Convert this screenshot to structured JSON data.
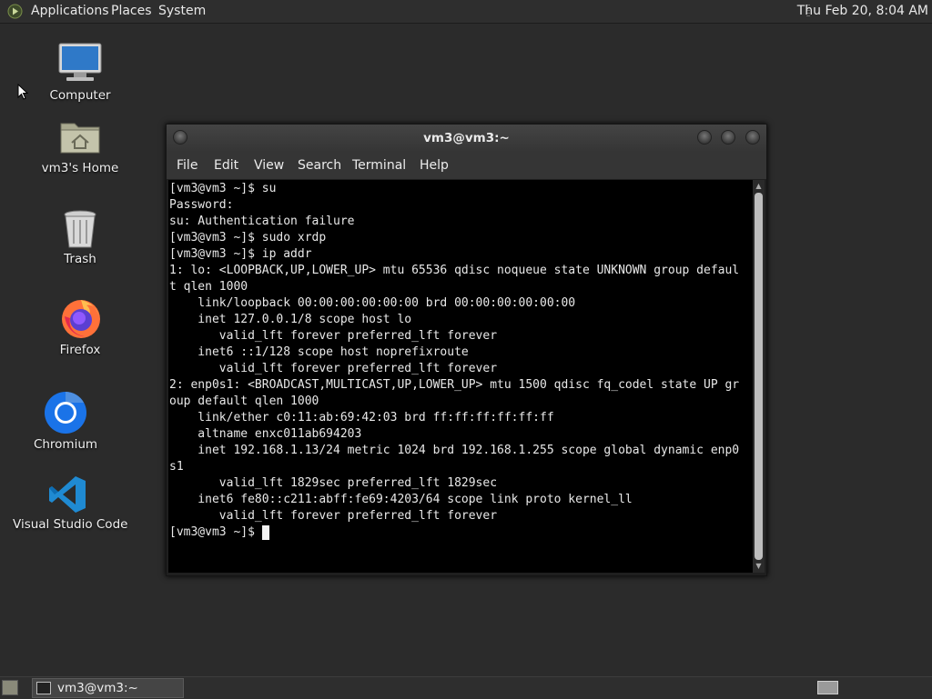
{
  "top_panel": {
    "menus": [
      "Applications",
      "Places",
      "System"
    ],
    "clock": "Thu Feb 20,  8:04 AM"
  },
  "desktop": {
    "icons": [
      {
        "label": "Computer",
        "icon": "computer-icon"
      },
      {
        "label": "vm3's Home",
        "icon": "home-folder-icon"
      },
      {
        "label": "Trash",
        "icon": "trash-icon"
      },
      {
        "label": "Firefox",
        "icon": "firefox-icon"
      },
      {
        "label": "Chromium",
        "icon": "chromium-icon"
      },
      {
        "label": "Visual Studio Code",
        "icon": "vscode-icon"
      }
    ]
  },
  "terminal": {
    "title": "vm3@vm3:~",
    "menu": [
      "File",
      "Edit",
      "View",
      "Search",
      "Terminal",
      "Help"
    ],
    "lines": [
      "[vm3@vm3 ~]$ su",
      "Password:",
      "su: Authentication failure",
      "[vm3@vm3 ~]$ sudo xrdp",
      "[vm3@vm3 ~]$ ip addr",
      "1: lo: <LOOPBACK,UP,LOWER_UP> mtu 65536 qdisc noqueue state UNKNOWN group defaul",
      "t qlen 1000",
      "    link/loopback 00:00:00:00:00:00 brd 00:00:00:00:00:00",
      "    inet 127.0.0.1/8 scope host lo",
      "       valid_lft forever preferred_lft forever",
      "    inet6 ::1/128 scope host noprefixroute",
      "       valid_lft forever preferred_lft forever",
      "2: enp0s1: <BROADCAST,MULTICAST,UP,LOWER_UP> mtu 1500 qdisc fq_codel state UP gr",
      "oup default qlen 1000",
      "    link/ether c0:11:ab:69:42:03 brd ff:ff:ff:ff:ff:ff",
      "    altname enxc011ab694203",
      "    inet 192.168.1.13/24 metric 1024 brd 192.168.1.255 scope global dynamic enp0",
      "s1",
      "       valid_lft 1829sec preferred_lft 1829sec",
      "    inet6 fe80::c211:abff:fe69:4203/64 scope link proto kernel_ll",
      "       valid_lft forever preferred_lft forever",
      "[vm3@vm3 ~]$ "
    ]
  },
  "taskbar": {
    "window_button": "vm3@vm3:~"
  },
  "colors": {
    "desktop": "#2b2b2b",
    "panel": "#2e2e2e",
    "terminal_bg": "#000000",
    "terminal_fg": "#e8e8e8"
  }
}
